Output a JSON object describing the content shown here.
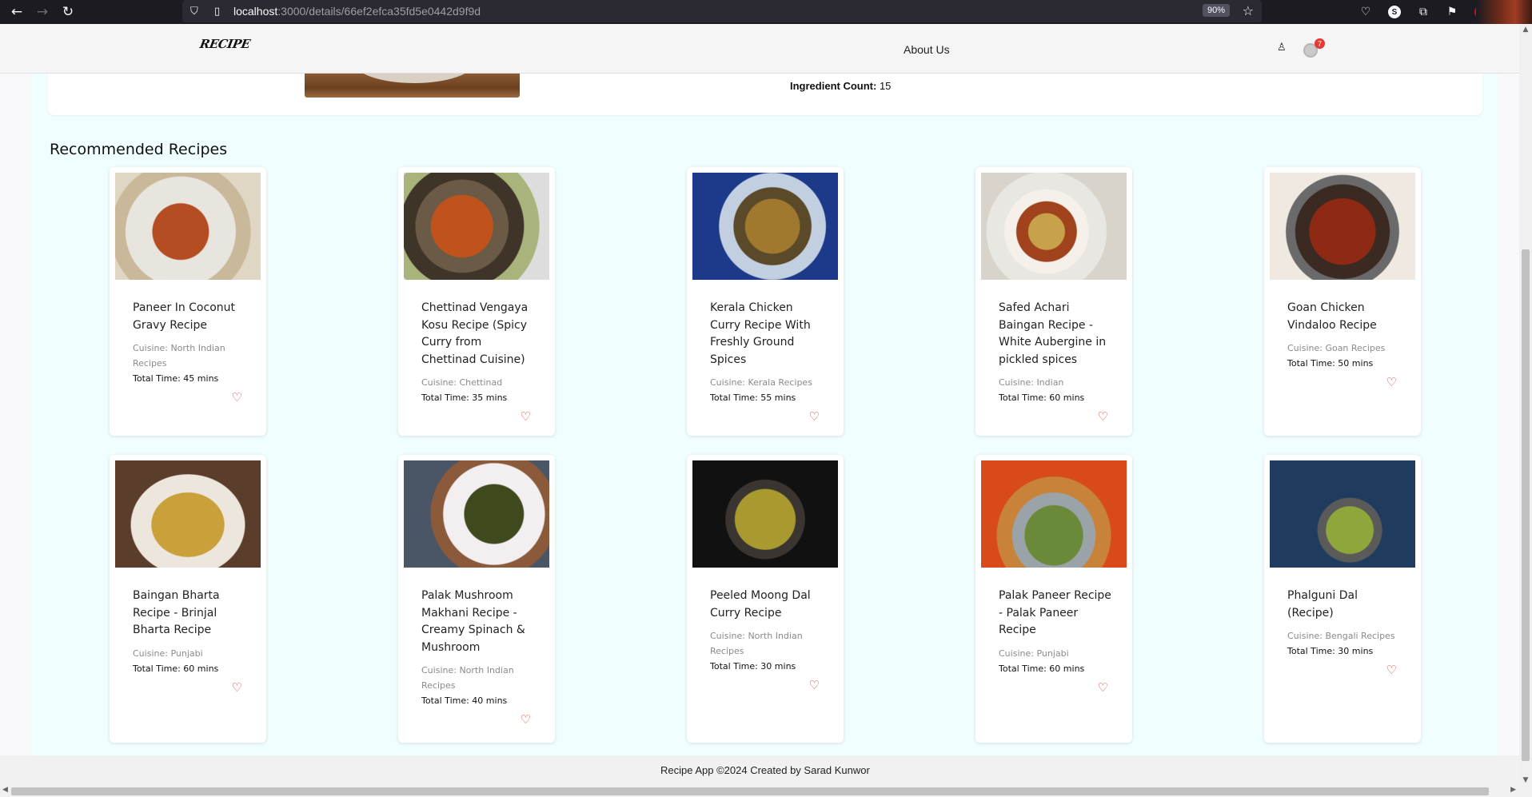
{
  "browser": {
    "url_host": "localhost",
    "url_rest": ":3000/details/66ef2efca35fd5e0442d9f9d",
    "zoom": "90%",
    "ext_badge": "S",
    "ext_red": "UD"
  },
  "header": {
    "logo": "RECIPE",
    "about": "About Us",
    "cart_count": "7"
  },
  "detail": {
    "ingredient_label": "Ingredient Count:",
    "ingredient_value": "15"
  },
  "section_title": "Recommended Recipes",
  "recipes": [
    {
      "title": "Paneer In Coconut Gravy Recipe",
      "cuisine": "Cuisine: North Indian Recipes",
      "time": "Total Time: 45 mins"
    },
    {
      "title": "Chettinad Vengaya Kosu Recipe (Spicy Curry from Chettinad Cuisine)",
      "cuisine": "Cuisine: Chettinad",
      "time": "Total Time: 35 mins"
    },
    {
      "title": "Kerala Chicken Curry Recipe With Freshly Ground Spices",
      "cuisine": "Cuisine: Kerala Recipes",
      "time": "Total Time: 55 mins"
    },
    {
      "title": "Safed Achari Baingan Recipe - White Aubergine in pickled spices",
      "cuisine": "Cuisine: Indian",
      "time": "Total Time: 60 mins"
    },
    {
      "title": "Goan Chicken Vindaloo Recipe",
      "cuisine": "Cuisine: Goan Recipes",
      "time": "Total Time: 50 mins"
    },
    {
      "title": "Baingan Bharta Recipe - Brinjal Bharta Recipe",
      "cuisine": "Cuisine: Punjabi",
      "time": "Total Time: 60 mins"
    },
    {
      "title": "Palak Mushroom Makhani Recipe - Creamy Spinach & Mushroom",
      "cuisine": "Cuisine: North Indian Recipes",
      "time": "Total Time: 40 mins"
    },
    {
      "title": "Peeled Moong Dal Curry Recipe",
      "cuisine": "Cuisine: North Indian Recipes",
      "time": "Total Time: 30 mins"
    },
    {
      "title": "Palak Paneer Recipe - Palak Paneer Recipe",
      "cuisine": "Cuisine: Punjabi",
      "time": "Total Time: 60 mins"
    },
    {
      "title": "Phalguni Dal (Recipe)",
      "cuisine": "Cuisine: Bengali Recipes",
      "time": "Total Time: 30 mins"
    }
  ],
  "footer": "Recipe App ©2024 Created by Sarad Kunwor"
}
